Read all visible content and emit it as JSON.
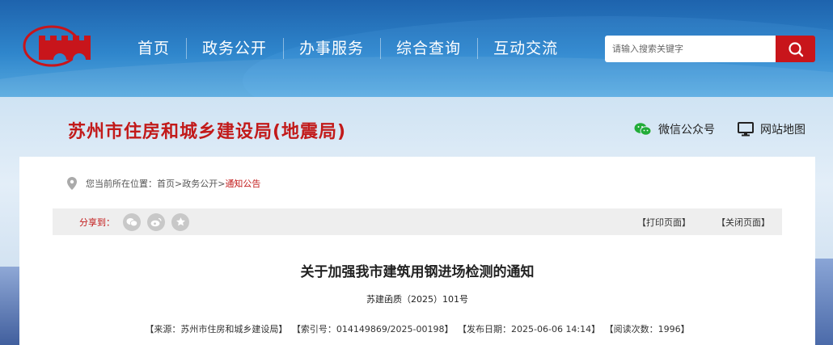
{
  "header": {
    "nav": [
      "首页",
      "政务公开",
      "办事服务",
      "综合查询",
      "互动交流"
    ],
    "search": {
      "placeholder": "请输入搜索关键字"
    }
  },
  "banner": {
    "site_title": "苏州市住房和城乡建设局(地震局)",
    "wechat_label": "微信公众号",
    "sitemap_label": "网站地图"
  },
  "breadcrumb": {
    "prefix": "您当前所在位置：",
    "items": [
      "首页",
      "政务公开",
      "通知公告"
    ],
    "separator": ">"
  },
  "share": {
    "label": "分享到：",
    "icons": [
      "wechat-icon",
      "weibo-icon",
      "favorite-icon"
    ],
    "print": "【打印页面】",
    "close": "【关闭页面】"
  },
  "article": {
    "title": "关于加强我市建筑用钢进场检测的通知",
    "doc_no": "苏建函质（2025）101号",
    "meta": {
      "source": "【来源：苏州市住房和城乡建设局】",
      "index": "【索引号：014149869/2025-00198】",
      "published": "【发布日期：2025-06-06 14:14】",
      "views": "【阅读次数：1996】"
    }
  },
  "colors": {
    "brand_red": "#c21a1a",
    "nav_blue": "#2f86cc",
    "search_button": "#c8151b"
  }
}
